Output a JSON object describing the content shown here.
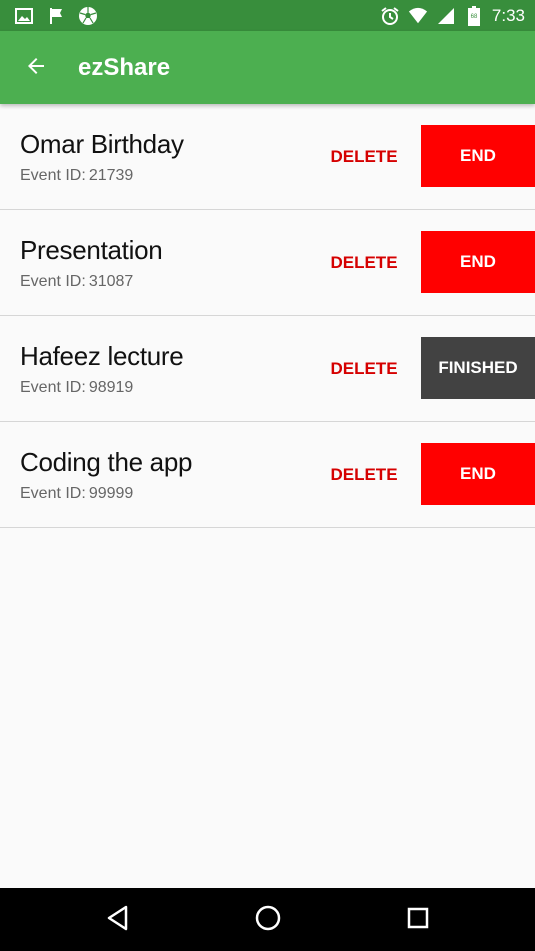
{
  "status_bar": {
    "time": "7:33",
    "left_icons": [
      "image-icon",
      "flag-icon",
      "soccer-ball-icon"
    ],
    "right_icons": [
      "alarm-icon",
      "wifi-icon",
      "signal-icon",
      "battery-icon"
    ]
  },
  "app_bar": {
    "title": "ezShare",
    "back_icon": "arrow-back-icon",
    "color": "#4caf50"
  },
  "events": [
    {
      "title": "Omar Birthday",
      "id_label": "Event ID:",
      "id": "21739",
      "delete_label": "DELETE",
      "action_label": "END",
      "action_state": "end"
    },
    {
      "title": "Presentation",
      "id_label": "Event ID:",
      "id": "31087",
      "delete_label": "DELETE",
      "action_label": "END",
      "action_state": "end"
    },
    {
      "title": "Hafeez lecture",
      "id_label": "Event ID:",
      "id": "98919",
      "delete_label": "DELETE",
      "action_label": "FINISHED",
      "action_state": "finished"
    },
    {
      "title": "Coding the app",
      "id_label": "Event ID:",
      "id": "99999",
      "delete_label": "DELETE",
      "action_label": "END",
      "action_state": "end"
    }
  ],
  "colors": {
    "end_button": "#ff0000",
    "finished_button": "#424242",
    "delete_text": "#d50000",
    "status_bar": "#388e3c"
  },
  "nav_bar": {
    "icons": [
      "back-triangle-icon",
      "home-circle-icon",
      "recents-square-icon"
    ]
  }
}
